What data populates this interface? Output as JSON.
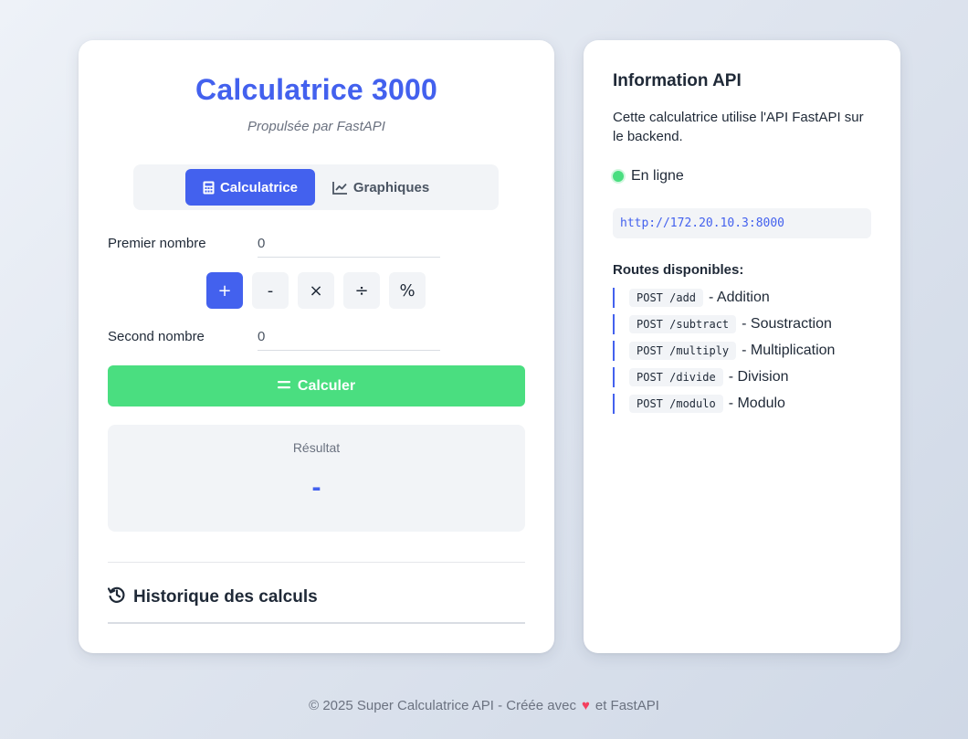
{
  "calculator": {
    "title": "Calculatrice 3000",
    "subtitle": "Propulsée par FastAPI",
    "tabs": [
      {
        "label": "Calculatrice",
        "icon": "calculator-icon",
        "active": true
      },
      {
        "label": "Graphiques",
        "icon": "chart-line-icon",
        "active": false
      }
    ],
    "first_number": {
      "label": "Premier nombre",
      "value": "0"
    },
    "second_number": {
      "label": "Second nombre",
      "value": "0"
    },
    "operators": [
      "+",
      "-",
      "×",
      "÷",
      "%"
    ],
    "selected_operator": "+",
    "compute_button": {
      "label": "Calculer",
      "icon": "equals-icon"
    },
    "result": {
      "label": "Résultat",
      "value": "-"
    },
    "history": {
      "title": "Historique des calculs",
      "icon": "history-icon"
    }
  },
  "api_info": {
    "title": "Information API",
    "description": "Cette calculatrice utilise l'API FastAPI sur le backend.",
    "status": {
      "label": "En ligne",
      "color": "#4ade80"
    },
    "url": "http://172.20.10.3:8000",
    "routes_title": "Routes disponibles:",
    "routes": [
      {
        "endpoint": "POST /add",
        "description": "- Addition"
      },
      {
        "endpoint": "POST /subtract",
        "description": "- Soustraction"
      },
      {
        "endpoint": "POST /multiply",
        "description": "- Multiplication"
      },
      {
        "endpoint": "POST /divide",
        "description": "- Division"
      },
      {
        "endpoint": "POST /modulo",
        "description": "- Modulo"
      }
    ]
  },
  "footer": {
    "text_before": "© 2025 Super Calculatrice API - Créée avec",
    "heart": "♥",
    "text_after": "et FastAPI"
  },
  "colors": {
    "accent": "#4361ee",
    "success": "#4ade80",
    "heart": "#f43f5e"
  }
}
